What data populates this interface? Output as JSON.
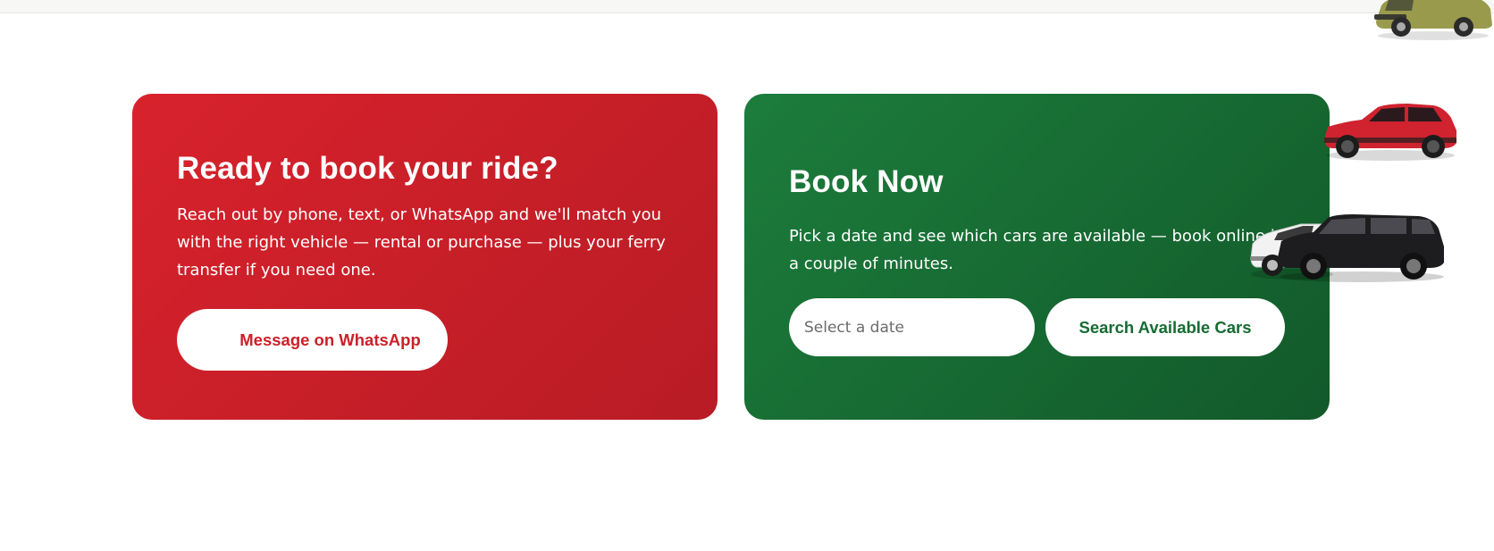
{
  "booking_card": {
    "title": "Ready to book your ride?",
    "description": "Reach out by phone, text, or WhatsApp and we'll match you with the right vehicle — rental or purchase — plus your ferry transfer if you need one.",
    "whatsapp_button": "Message on WhatsApp"
  },
  "book_now_card": {
    "title": "Book Now",
    "description": "Pick a date and see which cars are available — book online in a couple of minutes.",
    "date_placeholder": "Select a date",
    "date_value": "",
    "search_button": "Search Available Cars"
  },
  "colors": {
    "red_card": "#d8222c",
    "green_card": "#1c7d3c",
    "whatsapp_text": "#cc2029",
    "search_text": "#166b32"
  },
  "decorations": {
    "cars": [
      "yellow-car-icon",
      "red-suv-icon",
      "white-suv-icon",
      "black-suv-icon"
    ]
  }
}
